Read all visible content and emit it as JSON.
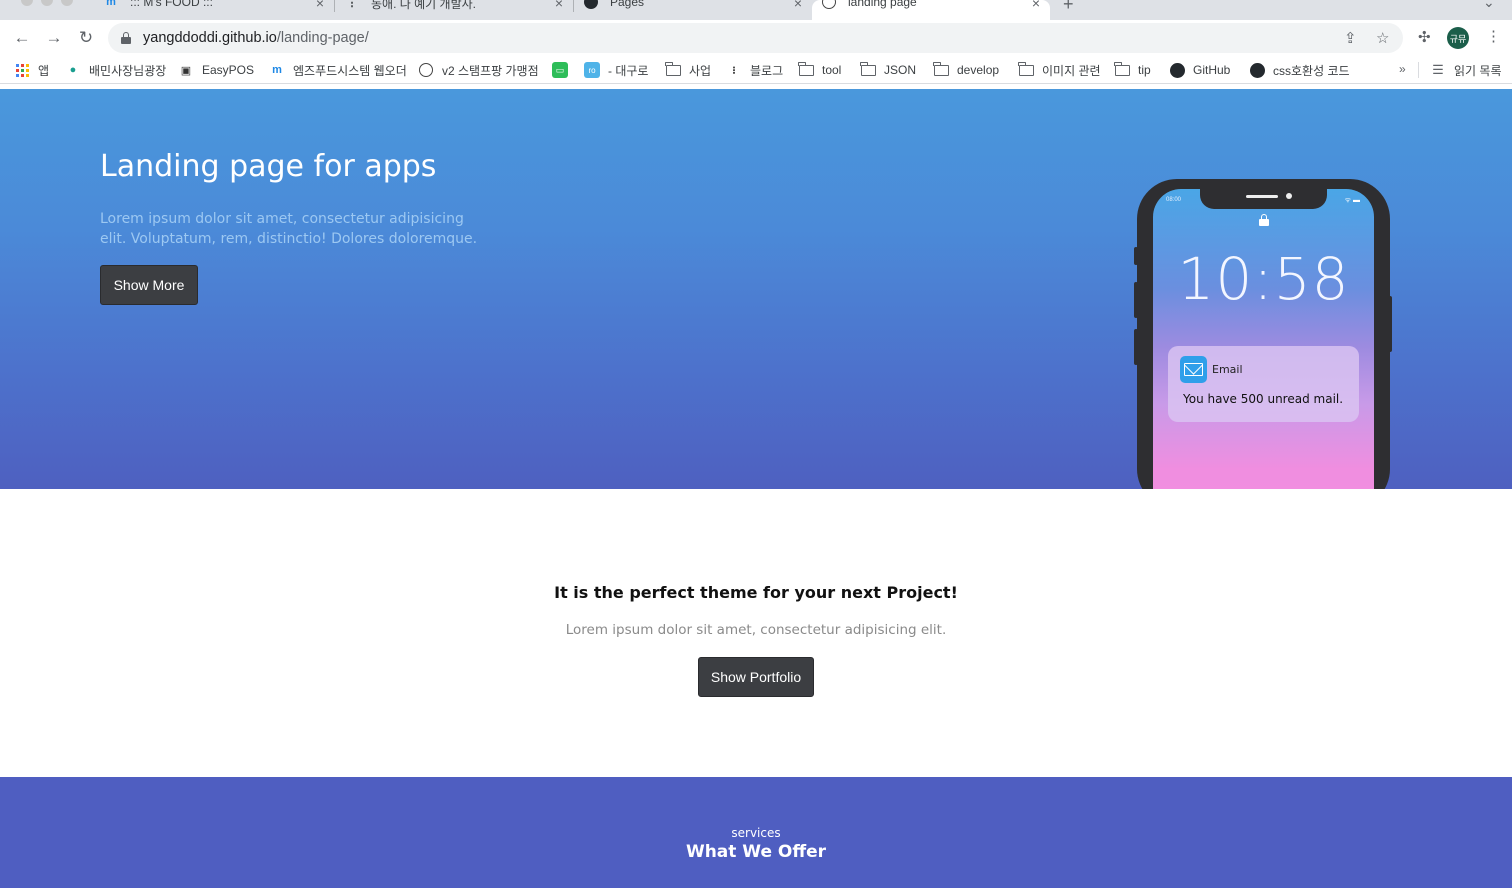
{
  "browser": {
    "tabs": [
      {
        "title": "::: M's FOOD :::",
        "favicon": "m-logo-icon",
        "active": false
      },
      {
        "title": "동애. 나 예기 개발사.",
        "favicon": "dots-icon",
        "active": false
      },
      {
        "title": "Pages",
        "favicon": "github-icon",
        "active": false
      },
      {
        "title": "landing page",
        "favicon": "globe-icon",
        "active": true
      }
    ],
    "new_tab": "+",
    "close_glyph": "×",
    "url_host": "yangddoddi.github.io",
    "url_path": "/landing-page/",
    "profile_initials": "규뮤",
    "bookmarks": [
      {
        "label": "앱",
        "icon": "apps-grid-icon"
      },
      {
        "label": "배민사장님광장",
        "icon": "baemin-icon"
      },
      {
        "label": "EasyPOS",
        "icon": "easypos-icon"
      },
      {
        "label": "엠즈푸드시스템 웹오더",
        "icon": "m-logo-icon"
      },
      {
        "label": "v2 스탬프팡 가맹점",
        "icon": "globe-icon"
      },
      {
        "label": "",
        "icon": "chat-icon"
      },
      {
        "label": "- 대구로",
        "icon": "daeguro-icon"
      },
      {
        "label": "사업",
        "icon": "folder-icon"
      },
      {
        "label": "블로그",
        "icon": "dots-icon"
      },
      {
        "label": "tool",
        "icon": "folder-icon"
      },
      {
        "label": "JSON",
        "icon": "folder-icon"
      },
      {
        "label": "develop",
        "icon": "folder-icon"
      },
      {
        "label": "이미지 관련",
        "icon": "folder-icon"
      },
      {
        "label": "tip",
        "icon": "folder-icon"
      },
      {
        "label": "GitHub",
        "icon": "github-icon"
      },
      {
        "label": "css호환성 코드",
        "icon": "github-icon"
      }
    ],
    "bookmarks_more": "»",
    "reading_list": "읽기 목록"
  },
  "hero": {
    "title": "Landing page for apps",
    "text": "Lorem ipsum dolor sit amet, consectetur adipisicing elit. Voluptatum, rem, distinctio! Dolores doloremque.",
    "button": "Show More"
  },
  "phone": {
    "status_time": "08:00",
    "clock": "10:58",
    "notification_app": "Email",
    "notification_message": "You have 500 unread mail."
  },
  "theme": {
    "title": "It is the perfect theme for your next Project!",
    "text": "Lorem ipsum dolor sit amet, consectetur adipisicing elit.",
    "button": "Show Portfolio"
  },
  "services": {
    "label": "services",
    "title": "What We Offer"
  },
  "colors": {
    "hero_top": "#4a98dc",
    "hero_bottom": "#4e60c0",
    "button_dark": "#3c3e42",
    "services_bg": "#4f5ec1"
  }
}
